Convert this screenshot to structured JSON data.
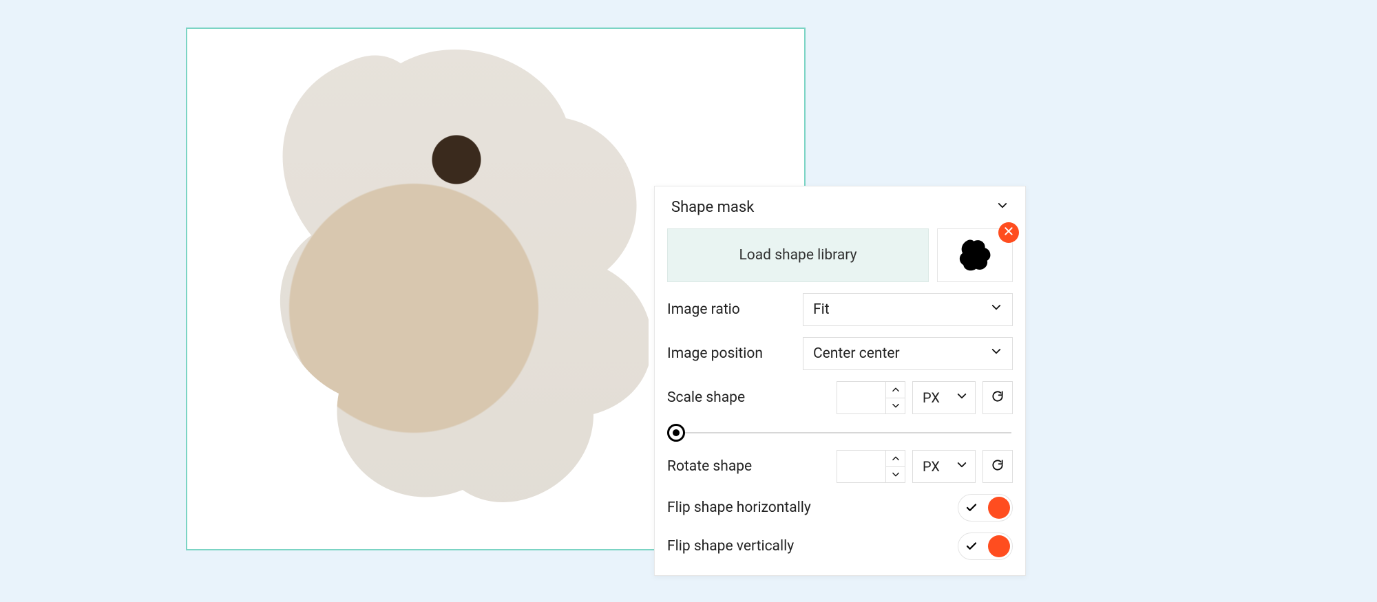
{
  "panel": {
    "title": "Shape mask",
    "loadLibrary": "Load shape library",
    "imageRatio": {
      "label": "Image ratio",
      "value": "Fit"
    },
    "imagePosition": {
      "label": "Image position",
      "value": "Center center"
    },
    "scale": {
      "label": "Scale shape",
      "value": "",
      "unit": "PX"
    },
    "rotate": {
      "label": "Rotate shape",
      "value": "",
      "unit": "PX"
    },
    "flipH": {
      "label": "Flip shape horizontally",
      "on": true
    },
    "flipV": {
      "label": "Flip shape vertically",
      "on": true
    }
  },
  "colors": {
    "accent": "#ff4d1f",
    "frame": "#7bd4c4",
    "pageBg": "#e9f3fb"
  }
}
